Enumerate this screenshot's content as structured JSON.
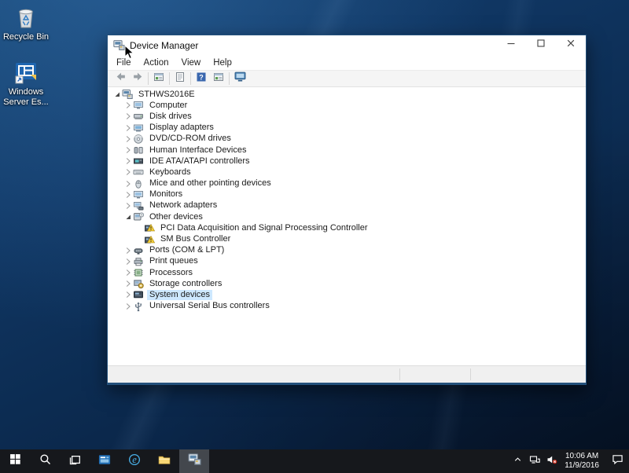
{
  "desktop": {
    "icons": [
      {
        "name": "recycle-bin",
        "label": "Recycle Bin",
        "icon": "recycle-bin-icon"
      },
      {
        "name": "windows-server-shortcut",
        "label": "Windows Server Es...",
        "icon": "windows-server-icon"
      }
    ]
  },
  "window": {
    "title": "Device Manager",
    "app_icon": "device-manager-icon",
    "controls": [
      {
        "name": "minimize-button",
        "icon": "minimize-icon"
      },
      {
        "name": "maximize-button",
        "icon": "maximize-icon"
      },
      {
        "name": "close-button",
        "icon": "close-icon"
      }
    ],
    "menus": [
      {
        "label": "File"
      },
      {
        "label": "Action"
      },
      {
        "label": "View"
      },
      {
        "label": "Help"
      }
    ],
    "toolbar": [
      {
        "name": "back-button",
        "icon": "back-arrow-icon"
      },
      {
        "name": "forward-button",
        "icon": "forward-arrow-icon"
      },
      {
        "name": "separator"
      },
      {
        "name": "console-tree-button",
        "icon": "console-tree-icon"
      },
      {
        "name": "separator"
      },
      {
        "name": "properties-button",
        "icon": "properties-icon"
      },
      {
        "name": "separator"
      },
      {
        "name": "help-button",
        "icon": "help-icon"
      },
      {
        "name": "console-window-button",
        "icon": "console-tree-icon"
      },
      {
        "name": "separator"
      },
      {
        "name": "scan-hardware-button",
        "icon": "scan-hardware-icon"
      }
    ],
    "tree": [
      {
        "label": "STHWS2016E",
        "icon": "computer-root-icon",
        "level": 0,
        "state": "expanded"
      },
      {
        "label": "Computer",
        "icon": "computer-icon",
        "level": 1,
        "state": "collapsed"
      },
      {
        "label": "Disk drives",
        "icon": "disk-drive-icon",
        "level": 1,
        "state": "collapsed"
      },
      {
        "label": "Display adapters",
        "icon": "display-adapter-icon",
        "level": 1,
        "state": "collapsed"
      },
      {
        "label": "DVD/CD-ROM drives",
        "icon": "dvd-drive-icon",
        "level": 1,
        "state": "collapsed"
      },
      {
        "label": "Human Interface Devices",
        "icon": "hid-icon",
        "level": 1,
        "state": "collapsed"
      },
      {
        "label": "IDE ATA/ATAPI controllers",
        "icon": "ide-controller-icon",
        "level": 1,
        "state": "collapsed"
      },
      {
        "label": "Keyboards",
        "icon": "keyboard-icon",
        "level": 1,
        "state": "collapsed"
      },
      {
        "label": "Mice and other pointing devices",
        "icon": "mouse-icon",
        "level": 1,
        "state": "collapsed"
      },
      {
        "label": "Monitors",
        "icon": "monitor-icon",
        "level": 1,
        "state": "collapsed"
      },
      {
        "label": "Network adapters",
        "icon": "network-adapter-icon",
        "level": 1,
        "state": "collapsed"
      },
      {
        "label": "Other devices",
        "icon": "other-device-icon",
        "level": 1,
        "state": "expanded"
      },
      {
        "label": "PCI Data Acquisition and Signal Processing Controller",
        "icon": "unknown-device-warning-icon",
        "level": 2,
        "state": "none"
      },
      {
        "label": "SM Bus Controller",
        "icon": "unknown-device-warning-icon",
        "level": 2,
        "state": "none"
      },
      {
        "label": "Ports (COM & LPT)",
        "icon": "ports-icon",
        "level": 1,
        "state": "collapsed"
      },
      {
        "label": "Print queues",
        "icon": "print-queue-icon",
        "level": 1,
        "state": "collapsed"
      },
      {
        "label": "Processors",
        "icon": "processor-icon",
        "level": 1,
        "state": "collapsed"
      },
      {
        "label": "Storage controllers",
        "icon": "storage-controller-icon",
        "level": 1,
        "state": "collapsed"
      },
      {
        "label": "System devices",
        "icon": "system-device-icon",
        "level": 1,
        "state": "collapsed",
        "selected": true
      },
      {
        "label": "Universal Serial Bus controllers",
        "icon": "usb-controller-icon",
        "level": 1,
        "state": "collapsed"
      }
    ]
  },
  "taskbar": {
    "items": [
      {
        "name": "start-button",
        "icon": "windows-logo-icon"
      },
      {
        "name": "search-button",
        "icon": "search-icon"
      },
      {
        "name": "task-view-button",
        "icon": "task-view-icon"
      },
      {
        "name": "server-manager-button",
        "icon": "server-manager-icon"
      },
      {
        "name": "internet-explorer-button",
        "icon": "internet-explorer-icon"
      },
      {
        "name": "file-explorer-button",
        "icon": "file-explorer-icon"
      },
      {
        "name": "device-manager-button",
        "icon": "device-manager-taskbar-icon",
        "active": true
      }
    ],
    "tray": {
      "icons": [
        {
          "name": "tray-expand-button",
          "icon": "chevron-up-icon"
        },
        {
          "name": "network-status",
          "icon": "network-tray-icon"
        },
        {
          "name": "volume-status",
          "icon": "volume-muted-icon"
        }
      ],
      "clock": {
        "time": "10:06 AM",
        "date": "11/9/2016"
      },
      "action_center": {
        "name": "action-center-button",
        "icon": "action-center-icon"
      }
    }
  },
  "colors": {
    "selection": "#cde8ff",
    "window_border": "#24517c",
    "taskbar_bg": "#16181c",
    "taskbar_active": "#43474d",
    "warning_yellow": "#f4ce3a",
    "mute_red": "#c42b1c"
  }
}
